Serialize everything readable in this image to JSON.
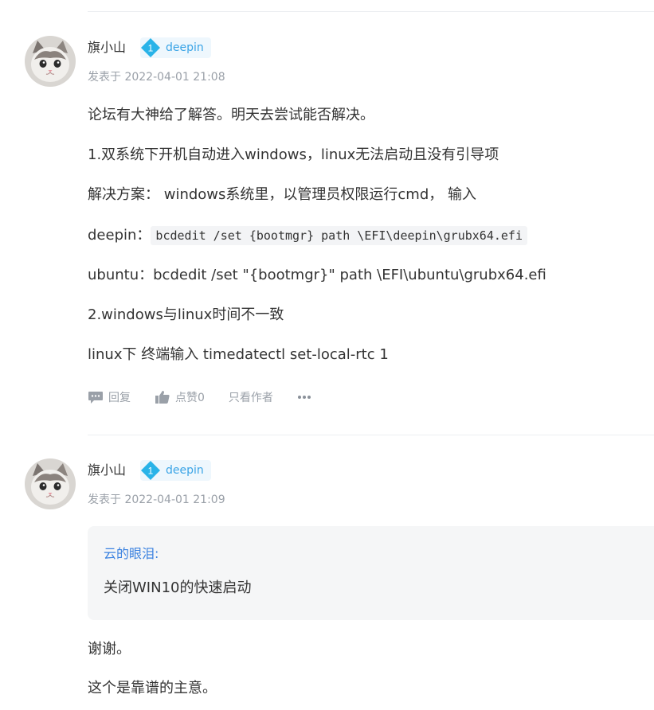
{
  "posts": [
    {
      "author": "旗小山",
      "badge": {
        "level": "1",
        "label": "deepin"
      },
      "posted": "发表于 2022-04-01 21:08",
      "paragraphs": [
        "论坛有大神给了解答。明天去尝试能否解决。",
        "1.双系统下开机自动进入windows，linux无法启动且没有引导项",
        "解决方案： windows系统里，以管理员权限运行cmd， 输入"
      ],
      "deepin_prefix": "deepin：",
      "deepin_code": "bcdedit /set {bootmgr} path \\EFI\\deepin\\grubx64.efi",
      "paragraphs_after": [
        "ubuntu：bcdedit /set \"{bootmgr}\" path \\EFI\\ubuntu\\grubx64.efi",
        "2.windows与linux时间不一致",
        "linux下 终端输入 timedatectl set-local-rtc 1"
      ],
      "actions": {
        "reply": "回复",
        "like": "点赞0",
        "only_author": "只看作者",
        "more_icon": "more-dots-icon"
      }
    },
    {
      "author": "旗小山",
      "badge": {
        "level": "1",
        "label": "deepin"
      },
      "posted": "发表于 2022-04-01 21:09",
      "quote": {
        "author": "云的眼泪:",
        "text": "关闭WIN10的快速启动"
      },
      "paragraphs": [
        "谢谢。",
        "这个是靠谱的主意。"
      ]
    }
  ],
  "colors": {
    "badge_blue": "#3aa4e6",
    "badge_diamond": "#29b3e8",
    "quote_author": "#3b82e0"
  }
}
